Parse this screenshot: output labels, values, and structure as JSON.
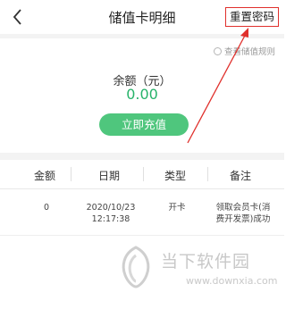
{
  "header": {
    "back_icon": "chevron-left-icon",
    "title": "储值卡明细",
    "reset_label": "重置密码"
  },
  "rules_link": {
    "icon": "info-icon",
    "label": "查看储值规则"
  },
  "balance": {
    "label": "余额（元）",
    "value": "0.00",
    "value_color": "#27b36a"
  },
  "recharge_button": {
    "label": "立即充值",
    "color": "#4fc67d"
  },
  "table": {
    "columns": [
      "金额",
      "日期",
      "类型",
      "备注"
    ],
    "rows": [
      {
        "amount": "0",
        "date": "2020/10/23",
        "time": "12:17:38",
        "type": "开卡",
        "note_line1": "领取会员卡(消",
        "note_line2": "费开发票)成功"
      }
    ]
  },
  "watermark": {
    "title": "当下软件园",
    "url": "www.downxia.com"
  },
  "annotation": {
    "highlight_color": "#e0302c"
  }
}
